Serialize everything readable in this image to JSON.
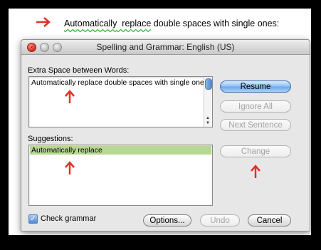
{
  "document": {
    "text_part1": "Automatically",
    "text_gap": "  ",
    "text_part2": "replace",
    "text_rest": " double spaces with single ones:"
  },
  "window": {
    "title": "Spelling and Grammar: English (US)"
  },
  "issue": {
    "label": "Extra Space between Words:",
    "text": "Automatically  replace double spaces with single ones:"
  },
  "suggestions": {
    "label": "Suggestions:",
    "items": [
      "Automatically replace"
    ]
  },
  "buttons": {
    "resume": "Resume",
    "ignore_all": "Ignore All",
    "next_sentence": "Next Sentence",
    "change": "Change",
    "options": "Options...",
    "undo": "Undo",
    "cancel": "Cancel"
  },
  "check_grammar": {
    "label": "Check grammar",
    "checked": true
  },
  "colors": {
    "annotation_arrow": "#e0302a",
    "squiggle": "#2db52d",
    "selection": "#b6d88f"
  },
  "icons": [
    "right-arrow-annotation-icon",
    "up-arrow-annotation-icon",
    "check-icon",
    "close-icon"
  ]
}
